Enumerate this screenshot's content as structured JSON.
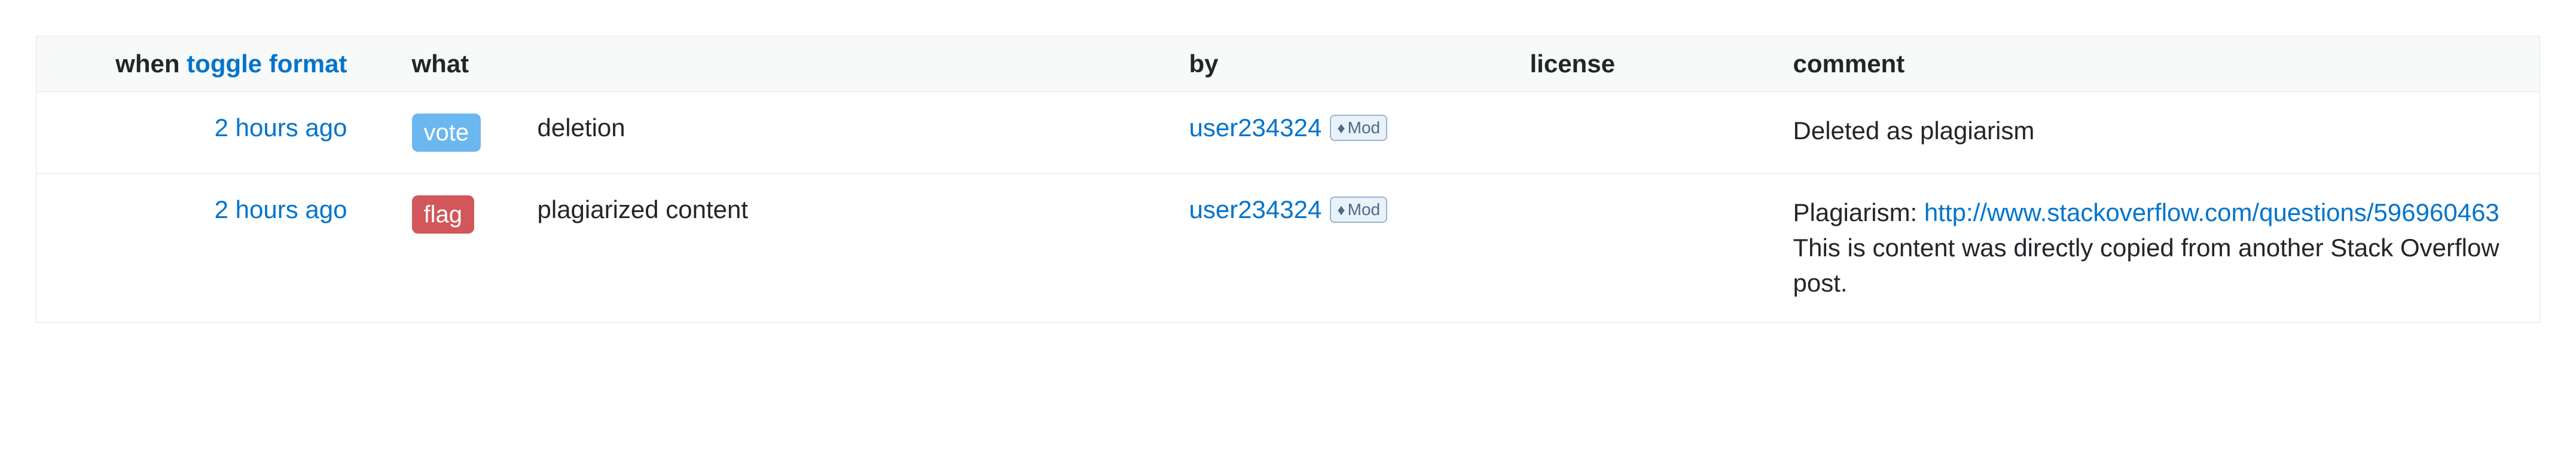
{
  "headers": {
    "when_label": "when",
    "toggle_format": "toggle format",
    "what": "what",
    "by": "by",
    "license": "license",
    "comment": "comment"
  },
  "mod_badge": {
    "text": "Mod",
    "diamond": "♦"
  },
  "rows": [
    {
      "time": "2 hours ago",
      "action_type": "vote",
      "action_class": "badge-vote",
      "description": "deletion",
      "user": "user234324",
      "is_mod": true,
      "license": "",
      "comment_segments": [
        {
          "kind": "text",
          "text": "Deleted as plagiarism"
        }
      ]
    },
    {
      "time": "2 hours ago",
      "action_type": "flag",
      "action_class": "badge-flag",
      "description": "plagiarized content",
      "user": "user234324",
      "is_mod": true,
      "license": "",
      "comment_segments": [
        {
          "kind": "text",
          "text": "Plagiarism: "
        },
        {
          "kind": "link",
          "text": "http://www.stackoverflow.com/questions/596960463"
        },
        {
          "kind": "break"
        },
        {
          "kind": "text",
          "text": "This is content was directly copied from another Stack Overflow post."
        }
      ]
    }
  ]
}
